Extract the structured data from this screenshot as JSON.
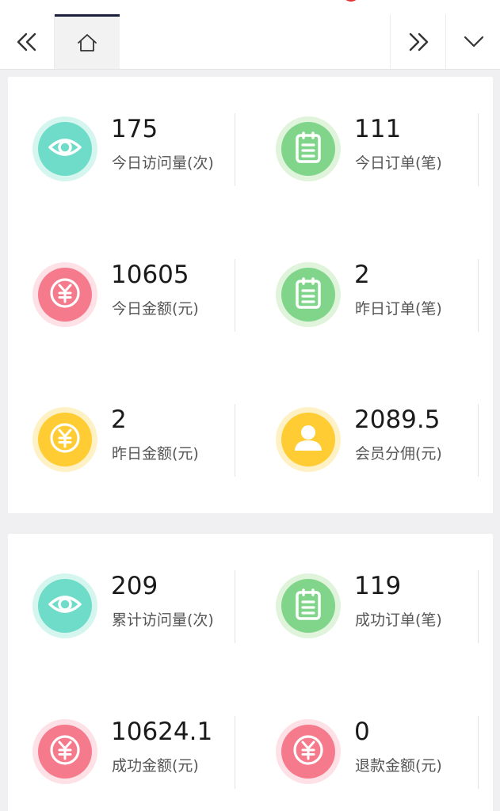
{
  "nav": {
    "prev_icon": "double-chevron-left-icon",
    "home_icon": "home-icon",
    "next_icon": "double-chevron-right-icon",
    "more_icon": "chevron-down-icon"
  },
  "colors": {
    "teal": "#6fdcc9",
    "green": "#80d58b",
    "pink": "#f57a8b",
    "yellow": "#ffcc33",
    "active_tab_border": "#1b1f3b"
  },
  "today_stats": [
    {
      "value": "175",
      "label": "今日访问量(次)",
      "icon": "eye-icon",
      "color": "teal"
    },
    {
      "value": "111",
      "label": "今日订单(笔)",
      "icon": "clipboard-icon",
      "color": "green"
    },
    {
      "value": "10605",
      "label": "今日金额(元)",
      "icon": "yuan-coin-icon",
      "color": "pink"
    },
    {
      "value": "2",
      "label": "昨日订单(笔)",
      "icon": "clipboard-icon",
      "color": "green"
    },
    {
      "value": "2",
      "label": "昨日金额(元)",
      "icon": "yuan-coin-icon",
      "color": "yellow"
    },
    {
      "value": "2089.5",
      "label": "会员分佣(元)",
      "icon": "user-icon",
      "color": "yellow"
    }
  ],
  "total_stats": [
    {
      "value": "209",
      "label": "累计访问量(次)",
      "icon": "eye-icon",
      "color": "teal"
    },
    {
      "value": "119",
      "label": "成功订单(笔)",
      "icon": "clipboard-icon",
      "color": "green"
    },
    {
      "value": "10624.1",
      "label": "成功金额(元)",
      "icon": "yuan-coin-icon",
      "color": "pink"
    },
    {
      "value": "0",
      "label": "退款金额(元)",
      "icon": "yuan-coin-icon",
      "color": "pink"
    }
  ]
}
